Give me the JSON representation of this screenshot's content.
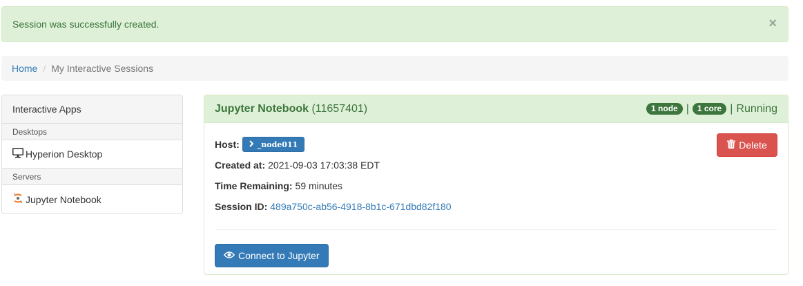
{
  "alert": {
    "message": "Session was successfully created.",
    "close": "×"
  },
  "breadcrumb": {
    "home": "Home",
    "separator": "/",
    "current": "My Interactive Sessions"
  },
  "apps": {
    "title": "Interactive Apps",
    "groups": [
      {
        "label": "Desktops",
        "items": [
          {
            "label": "Hyperion Desktop",
            "icon": "monitor-icon"
          }
        ]
      },
      {
        "label": "Servers",
        "items": [
          {
            "label": "Jupyter Notebook",
            "icon": "jupyter-icon"
          }
        ]
      }
    ]
  },
  "session": {
    "name": "Jupyter Notebook",
    "id": "(11657401)",
    "nodes": "1 node",
    "cores": "1 core",
    "sep": "|",
    "status": "Running",
    "host_label": "Host:",
    "host": "_node011",
    "created_label": "Created at:",
    "created": "2021-09-03 17:03:38 EDT",
    "remaining_label": "Time Remaining:",
    "remaining": "59 minutes",
    "sessionid_label": "Session ID:",
    "sessionid": "489a750c-ab56-4918-8b1c-671dbd82f180",
    "delete_label": "Delete",
    "connect_label": "Connect to Jupyter"
  },
  "colors": {
    "success_bg": "#dff0d8",
    "success_text": "#3c763d",
    "primary": "#337ab7",
    "danger": "#d9534f"
  }
}
